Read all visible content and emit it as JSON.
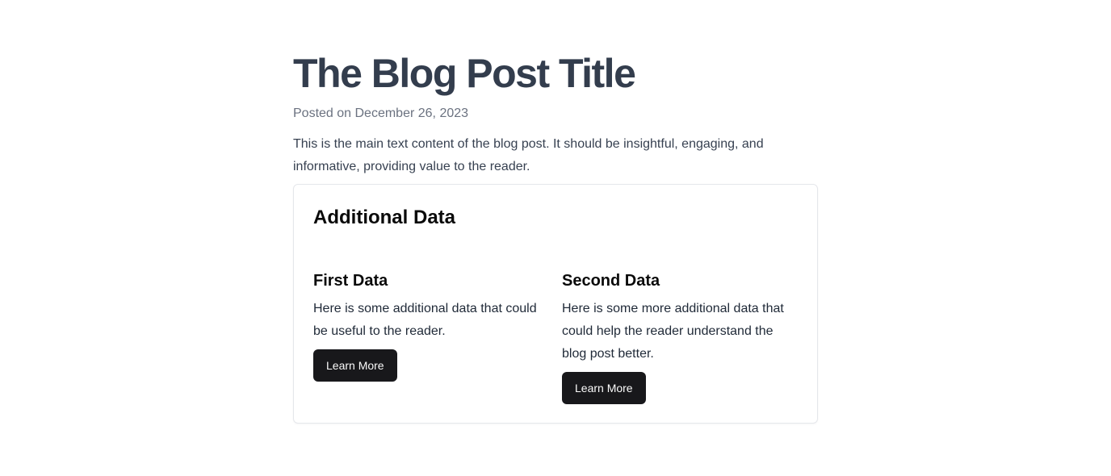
{
  "post": {
    "title": "The Blog Post Title",
    "posted_on": "Posted on December 26, 2023",
    "body": "This is the main text content of the blog post. It should be insightful, engaging, and informative, providing value to the reader."
  },
  "additional": {
    "heading": "Additional Data",
    "items": [
      {
        "title": "First Data",
        "text": "Here is some additional data that could be useful to the reader.",
        "button": "Learn More"
      },
      {
        "title": "Second Data",
        "text": "Here is some more additional data that could help the reader understand the blog post better.",
        "button": "Learn More"
      }
    ]
  },
  "colors": {
    "title": "#333d4d",
    "muted": "#6b7280",
    "button_bg": "#18181b",
    "button_text": "#fafafa",
    "card_border": "#e5e7eb"
  }
}
